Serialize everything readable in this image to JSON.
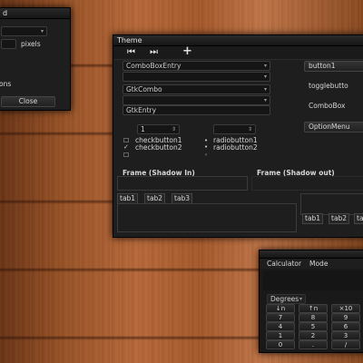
{
  "left_window": {
    "title": "d",
    "units_label": "pixels",
    "partial_label": "ons",
    "close_button": "Close"
  },
  "theme_window": {
    "title": "Theme",
    "toolbar_icons": [
      "go-first-icon",
      "go-last-icon",
      "add-icon"
    ],
    "combo_box_entry": "ComboBoxEntry",
    "gtk_combo": "GtkCombo",
    "gtk_entry": "GtkEntry",
    "spin_value": "1",
    "checkbutton1": "checkbutton1",
    "checkbutton2": "checkbutton2",
    "radiobutton1": "radiobutton1",
    "radiobutton2": "radiobutton2",
    "frame_in_label": "Frame (Shadow In)",
    "frame_out_label": "Frame (Shadow out)",
    "tabs_left": [
      "tab1",
      "tab2",
      "tab3"
    ],
    "tabs_right": [
      "tab1",
      "tab2",
      "ta"
    ],
    "button1": "button1",
    "togglebutton": "togglebutto",
    "combobox": "ComboBox",
    "option_menu": "OptionMenu"
  },
  "calculator_window": {
    "menu": [
      "Calculator",
      "Mode"
    ],
    "angle_unit": "Degrees",
    "keys": [
      [
        "↓n",
        "↑n",
        "×10"
      ],
      [
        "7",
        "8",
        "9"
      ],
      [
        "4",
        "5",
        "6"
      ],
      [
        "1",
        "2",
        "3"
      ],
      [
        "0",
        ".",
        "/"
      ]
    ]
  }
}
